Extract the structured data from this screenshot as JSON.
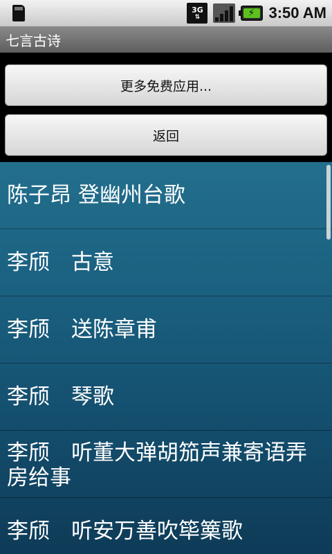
{
  "status_bar": {
    "time": "3:50 AM",
    "network_label": "3G",
    "icons": [
      "sd-card-icon",
      "3g-data-icon",
      "signal-icon",
      "battery-charging-icon"
    ]
  },
  "app": {
    "title": "七言古诗"
  },
  "buttons": {
    "more_apps": "更多免费应用...",
    "back": "返回"
  },
  "poems": [
    "陈子昂 登幽州台歌",
    "李颀　古意",
    "李颀　送陈章甫",
    "李颀　琴歌",
    "李颀　听董大弹胡笳声兼寄语弄房给事",
    "李颀　听安万善吹筚篥歌"
  ],
  "colors": {
    "list_top": "#236f8d",
    "list_bottom": "#0e3b57",
    "battery": "#5cc01d"
  }
}
